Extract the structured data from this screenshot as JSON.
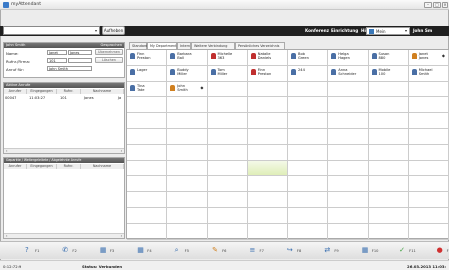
{
  "window": {
    "title": "myAttendant"
  },
  "toolbar": {
    "aufheben": "Aufheben"
  },
  "menu": {
    "items": [
      "Konferenz",
      "Einrichtung",
      "Hilfe"
    ]
  },
  "user": {
    "name": "Mein",
    "label": "John Sm"
  },
  "call_panel": {
    "header": "John Smith",
    "header_right": "Gesprochen",
    "name_label": "Name:",
    "name_first": "Janet",
    "name_last": "Jones",
    "rufnr_label": "Rufnr./Firma:",
    "rufnr_value": "101",
    "anruf_label": "Anruf für:",
    "anruf_value": "John Smith",
    "btn_ubernehmen": "Übernehmen",
    "btn_loschen": "Löschen"
  },
  "active_panel": {
    "header": "Aktive Anrufe",
    "columns": [
      "Anrufer",
      "Eingegangen",
      "Rufnr.",
      "Nachname"
    ],
    "rows": [
      {
        "anrufer": "00047",
        "eingang": "11:03:27",
        "rufnr": "101",
        "name": "Jones",
        "extra": "Ja"
      }
    ]
  },
  "parked_panel": {
    "header": "Geparkte / Weitergeleitete / Abgelehnte Anrufe",
    "columns": [
      "Anrufer",
      "Eingegangen",
      "Rufnr.",
      "Nachname"
    ]
  },
  "tabs": [
    "Standard",
    "My Department",
    "Intern",
    "Weitere Verbindung",
    "Persönliches Verzeichnis"
  ],
  "contacts": [
    {
      "first": "Finn",
      "last": "Preston",
      "color": "#4a6fa5"
    },
    {
      "first": "Barbara",
      "last": "Ball",
      "color": "#4a6fa5"
    },
    {
      "first": "Michelle",
      "last": "363",
      "color": "#c03030"
    },
    {
      "first": "Natalie",
      "last": "Daniels",
      "color": "#c03030"
    },
    {
      "first": "Bob",
      "last": "Green",
      "color": "#4a6fa5"
    },
    {
      "first": "Helga",
      "last": "Hagen",
      "color": "#4a6fa5"
    },
    {
      "first": "Susan",
      "last": "880",
      "color": "#4a6fa5"
    },
    {
      "first": "Janet",
      "last": "Jones",
      "color": "#d08020"
    },
    {
      "first": "Lager",
      "last": "",
      "color": "#4a6fa5"
    },
    {
      "first": "Buddy",
      "last": "Miller",
      "color": "#4a6fa5"
    },
    {
      "first": "Tom",
      "last": "Miller",
      "color": "#4a6fa5"
    },
    {
      "first": "Finn",
      "last": "Preston",
      "color": "#c03030"
    },
    {
      "first": "244",
      "last": "",
      "color": "#4a6fa5"
    },
    {
      "first": "Anna",
      "last": "Schneider",
      "color": "#4a6fa5"
    },
    {
      "first": "Mobile",
      "last": "100",
      "color": "#4a6fa5"
    },
    {
      "first": "Michael",
      "last": "Smith",
      "color": "#4a6fa5"
    },
    {
      "first": "Tina",
      "last": "Tate",
      "color": "#4a6fa5"
    },
    {
      "first": "John",
      "last": "Smith",
      "color": "#d08020"
    }
  ],
  "fkeys": [
    {
      "label": "F1",
      "icon": "help-icon",
      "color": "#3a6fb0"
    },
    {
      "label": "F2",
      "icon": "phone-icon",
      "color": "#3a6fb0"
    },
    {
      "label": "F3",
      "icon": "grid-icon",
      "color": "#3a6fb0"
    },
    {
      "label": "F4",
      "icon": "grid-icon",
      "color": "#3a6fb0"
    },
    {
      "label": "F5",
      "icon": "search-icon",
      "color": "#3a6fb0"
    },
    {
      "label": "F6",
      "icon": "handset-icon",
      "color": "#d08020"
    },
    {
      "label": "F7",
      "icon": "list-icon",
      "color": "#3a6fb0"
    },
    {
      "label": "F8",
      "icon": "transfer-icon",
      "color": "#3a6fb0"
    },
    {
      "label": "F9",
      "icon": "conference-icon",
      "color": "#3a6fb0"
    },
    {
      "label": "F10",
      "icon": "grid-icon",
      "color": "#3a6fb0"
    },
    {
      "label": "F11",
      "icon": "answer-icon",
      "color": "#40a040"
    },
    {
      "label": "F12",
      "icon": "hangup-icon",
      "color": "#d03030"
    }
  ],
  "status": {
    "time": "0:12:72:9",
    "text": "Status: Verbunden",
    "datetime": "26.03.2013 11:03:"
  }
}
